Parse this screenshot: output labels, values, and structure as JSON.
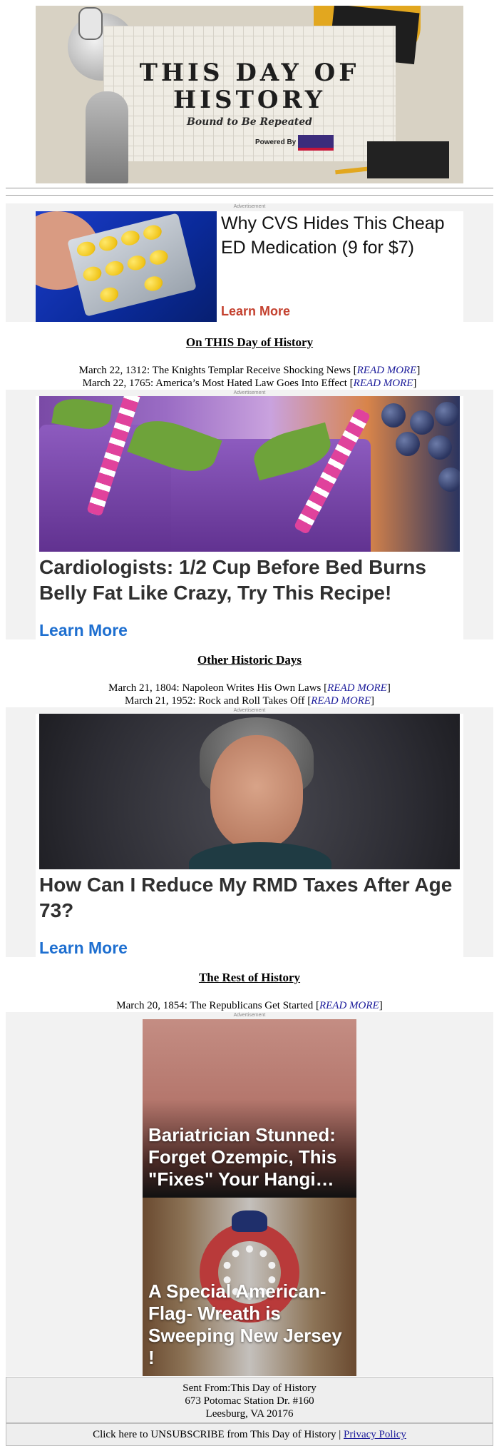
{
  "header": {
    "title_line1": "THIS DAY OF",
    "title_line2": "HISTORY",
    "tagline": "Bound to Be Repeated",
    "powered_by": "Powered By"
  },
  "advertisement_label": "Advertisement",
  "ad1": {
    "headline": "Why CVS Hides This Cheap ED Medication (9 for $7)",
    "cta": "Learn More"
  },
  "section1": {
    "title": "On THIS Day of History",
    "stories": [
      {
        "text": "March 22, 1312: The Knights Templar Receive Shocking News",
        "link": "READ MORE"
      },
      {
        "text": "March 22, 1765: America’s Most Hated Law Goes Into Effect",
        "link": "READ MORE"
      }
    ]
  },
  "ad2": {
    "headline": "Cardiologists: 1/2 Cup Before Bed Burns Belly Fat Like Crazy, Try This Recipe!",
    "cta": "Learn More"
  },
  "section2": {
    "title": "Other Historic Days",
    "stories": [
      {
        "text": "March 21, 1804: Napoleon Writes His Own Laws",
        "link": "READ MORE"
      },
      {
        "text": "March 21, 1952: Rock and Roll Takes Off",
        "link": "READ MORE"
      }
    ]
  },
  "ad3": {
    "headline": "How Can I Reduce My RMD Taxes After Age 73?",
    "cta": "Learn More"
  },
  "section3": {
    "title": "The Rest of History",
    "stories": [
      {
        "text": "March 20, 1854: The Republicans Get Started",
        "link": "READ MORE"
      }
    ]
  },
  "ad4": {
    "tile1_caption": "Bariatrician Stunned: Forget Ozempic, This \"Fixes\" Your Hangi…",
    "tile2_caption": "A Special American- Flag- Wreath is Sweeping New Jersey !"
  },
  "footer": {
    "sent_from": "Sent From:This Day of History",
    "address_line1": "673 Potomac Station Dr. #160",
    "address_line2": "Leesburg, VA 20176",
    "unsubscribe_text": "Click here to UNSUBSCRIBE from This Day of History",
    "separator": "|",
    "privacy_link": "Privacy Policy"
  },
  "colors": {
    "link": "#1a1a9a",
    "ad_cta_red": "#c4412f",
    "ad_cta_blue": "#1e6fd0",
    "band_gray": "#f2f2f2"
  }
}
